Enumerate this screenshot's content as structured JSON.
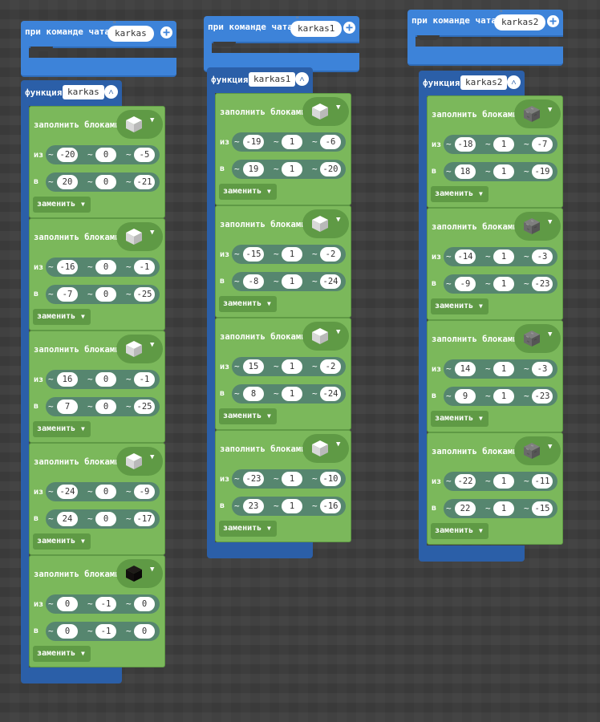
{
  "labels": {
    "chat_command": "при команде чата",
    "function": "функция",
    "fill_blocks": "заполнить блоками",
    "from": "из",
    "to": "в",
    "tilde": "~",
    "mode": "заменить"
  },
  "icons": {
    "plus": "plus-icon",
    "collapse": "collapse-chevron-icon",
    "dropdown": "caret-down-icon",
    "block_white": "white-block-icon",
    "block_black": "black-block-icon",
    "block_stone": "stone-block-icon"
  },
  "colors": {
    "event_blue": "#3d83d9",
    "function_blue": "#2b5fa8",
    "block_green": "#7bb85b",
    "coord_teal": "#56866f",
    "background": "#3d3d3d"
  },
  "groups": [
    {
      "command": "karkas",
      "function_name": "karkas",
      "fills": [
        {
          "block": "white",
          "from": [
            "-20",
            "0",
            "-5"
          ],
          "to": [
            "20",
            "0",
            "-21"
          ],
          "mode": "заменить"
        },
        {
          "block": "white",
          "from": [
            "-16",
            "0",
            "-1"
          ],
          "to": [
            "-7",
            "0",
            "-25"
          ],
          "mode": "заменить"
        },
        {
          "block": "white",
          "from": [
            "16",
            "0",
            "-1"
          ],
          "to": [
            "7",
            "0",
            "-25"
          ],
          "mode": "заменить"
        },
        {
          "block": "white",
          "from": [
            "-24",
            "0",
            "-9"
          ],
          "to": [
            "24",
            "0",
            "-17"
          ],
          "mode": "заменить"
        },
        {
          "block": "black",
          "from": [
            "0",
            "-1",
            "0"
          ],
          "to": [
            "0",
            "-1",
            "0"
          ],
          "mode": "заменить"
        }
      ]
    },
    {
      "command": "karkas1",
      "function_name": "karkas1",
      "fills": [
        {
          "block": "white",
          "from": [
            "-19",
            "1",
            "-6"
          ],
          "to": [
            "19",
            "1",
            "-20"
          ],
          "mode": "заменить"
        },
        {
          "block": "white",
          "from": [
            "-15",
            "1",
            "-2"
          ],
          "to": [
            "-8",
            "1",
            "-24"
          ],
          "mode": "заменить"
        },
        {
          "block": "white",
          "from": [
            "15",
            "1",
            "-2"
          ],
          "to": [
            "8",
            "1",
            "-24"
          ],
          "mode": "заменить"
        },
        {
          "block": "white",
          "from": [
            "-23",
            "1",
            "-10"
          ],
          "to": [
            "23",
            "1",
            "-16"
          ],
          "mode": "заменить"
        }
      ]
    },
    {
      "command": "karkas2",
      "function_name": "karkas2",
      "fills": [
        {
          "block": "stone",
          "from": [
            "-18",
            "1",
            "-7"
          ],
          "to": [
            "18",
            "1",
            "-19"
          ],
          "mode": "заменить"
        },
        {
          "block": "stone",
          "from": [
            "-14",
            "1",
            "-3"
          ],
          "to": [
            "-9",
            "1",
            "-23"
          ],
          "mode": "заменить"
        },
        {
          "block": "stone",
          "from": [
            "14",
            "1",
            "-3"
          ],
          "to": [
            "9",
            "1",
            "-23"
          ],
          "mode": "заменить"
        },
        {
          "block": "stone",
          "from": [
            "-22",
            "1",
            "-11"
          ],
          "to": [
            "22",
            "1",
            "-15"
          ],
          "mode": "заменить"
        }
      ]
    }
  ]
}
